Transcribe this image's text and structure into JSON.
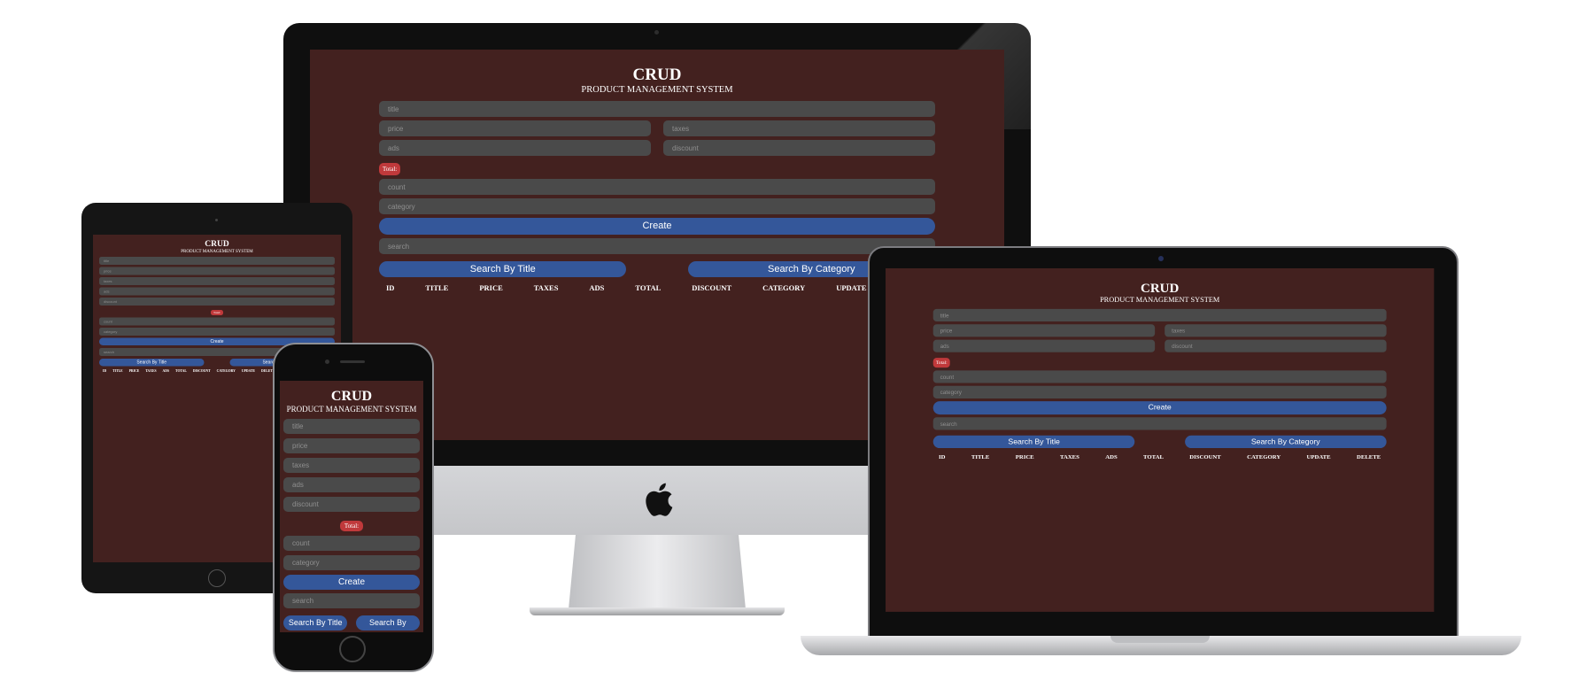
{
  "app": {
    "title": "CRUD",
    "subtitle": "PRODUCT MANAGEMENT SYSTEM",
    "placeholders": {
      "title": "title",
      "price": "price",
      "taxes": "taxes",
      "ads": "ads",
      "discount": "discount",
      "count": "count",
      "category": "category",
      "search": "search"
    },
    "total_label": "Total:",
    "create_label": "Create",
    "search_title_label": "Search By Title",
    "search_category_label": "Search By Category",
    "columns": [
      "ID",
      "TITLE",
      "PRICE",
      "TAXES",
      "ADS",
      "TOTAL",
      "DISCOUNT",
      "CATEGORY",
      "UPDATE",
      "DELETE"
    ]
  },
  "colors": {
    "app_background": "#43211f",
    "input_background": "#4a4a4a",
    "button": "#34579a",
    "total_badge": "#c0393b"
  },
  "icons": {
    "desktop_logo": "apple-logo-icon"
  }
}
